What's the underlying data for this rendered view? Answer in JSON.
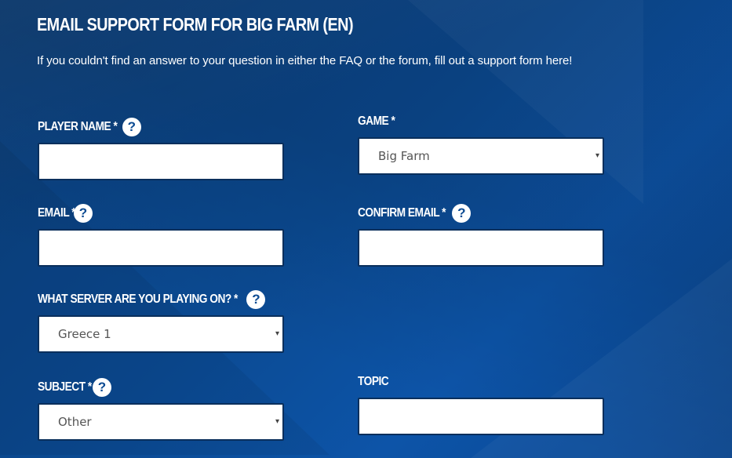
{
  "header": {
    "title": "EMAIL SUPPORT FORM FOR BIG FARM (EN)",
    "intro": "If you couldn't find an answer to your question in either the FAQ or the forum, fill out a support form here!"
  },
  "icons": {
    "help": "?",
    "dropdown_arrow": "▾"
  },
  "colors": {
    "background": "#0b4a92",
    "field_border": "#0a2f5c",
    "help_icon_bg": "#ffffff"
  },
  "form": {
    "player_name": {
      "label": "PLAYER NAME *",
      "value": ""
    },
    "game": {
      "label": "GAME *",
      "selected": "Big Farm"
    },
    "email": {
      "label": "EMAIL *",
      "value": ""
    },
    "confirm_email": {
      "label": "CONFIRM EMAIL *",
      "value": ""
    },
    "server": {
      "label": "WHAT SERVER ARE YOU PLAYING ON? *",
      "selected": "Greece 1"
    },
    "subject": {
      "label": "SUBJECT *",
      "selected": "Other"
    },
    "topic": {
      "label": "TOPIC",
      "value": ""
    }
  }
}
